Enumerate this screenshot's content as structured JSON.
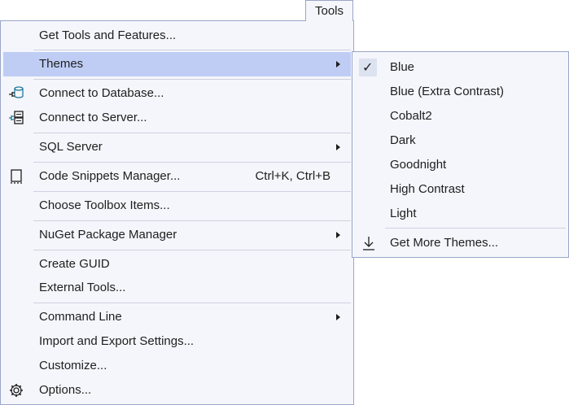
{
  "menubar": {
    "tools_label": "Tools"
  },
  "menu": {
    "get_tools": "Get Tools and Features...",
    "themes": "Themes",
    "connect_database": "Connect to Database...",
    "connect_server": "Connect to Server...",
    "sql_server": "SQL Server",
    "code_snippets": "Code Snippets Manager...",
    "code_snippets_shortcut": "Ctrl+K, Ctrl+B",
    "choose_toolbox": "Choose Toolbox Items...",
    "nuget": "NuGet Package Manager",
    "create_guid": "Create GUID",
    "external_tools": "External Tools...",
    "command_line": "Command Line",
    "import_export": "Import and Export Settings...",
    "customize": "Customize...",
    "options": "Options..."
  },
  "themes_submenu": {
    "selected": "Blue",
    "items": [
      "Blue",
      "Blue (Extra Contrast)",
      "Cobalt2",
      "Dark",
      "Goodnight",
      "High Contrast",
      "Light"
    ],
    "get_more": "Get More Themes..."
  },
  "icons": {
    "database": "database-plug-icon",
    "server": "server-plug-icon",
    "snippets": "snippet-icon",
    "options": "gear-icon",
    "check": "checkmark-icon",
    "download": "download-icon"
  },
  "colors": {
    "menu_bg": "#f5f6fb",
    "hover_bg": "#bfcdf5",
    "border": "#9aa6c8",
    "separator": "#cdd2df",
    "icon_accent": "#1e7a9e"
  }
}
